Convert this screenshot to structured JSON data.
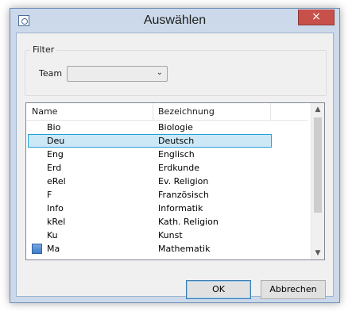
{
  "window": {
    "title": "Auswählen",
    "close_glyph": "×"
  },
  "filter": {
    "legend": "Filter",
    "team_label": "Team",
    "team_value": ""
  },
  "list": {
    "columns": [
      "Name",
      "Bezeichnung"
    ],
    "selected_index": 1,
    "rows": [
      {
        "name": "Bio",
        "bezeichnung": "Biologie"
      },
      {
        "name": "Deu",
        "bezeichnung": "Deutsch"
      },
      {
        "name": "Eng",
        "bezeichnung": "Englisch"
      },
      {
        "name": "Erd",
        "bezeichnung": "Erdkunde"
      },
      {
        "name": "eRel",
        "bezeichnung": "Ev. Religion"
      },
      {
        "name": "F",
        "bezeichnung": "Französisch"
      },
      {
        "name": "Info",
        "bezeichnung": "Informatik"
      },
      {
        "name": "kRel",
        "bezeichnung": "Kath. Religion"
      },
      {
        "name": "Ku",
        "bezeichnung": "Kunst"
      },
      {
        "name": "Ma",
        "bezeichnung": "Mathematik",
        "icon": "blue-square-icon"
      }
    ]
  },
  "buttons": {
    "ok": "OK",
    "cancel": "Abbrechen"
  },
  "colors": {
    "selection_fill": "#cce8f6",
    "selection_border": "#26a0da",
    "close_button": "#c7504a"
  }
}
